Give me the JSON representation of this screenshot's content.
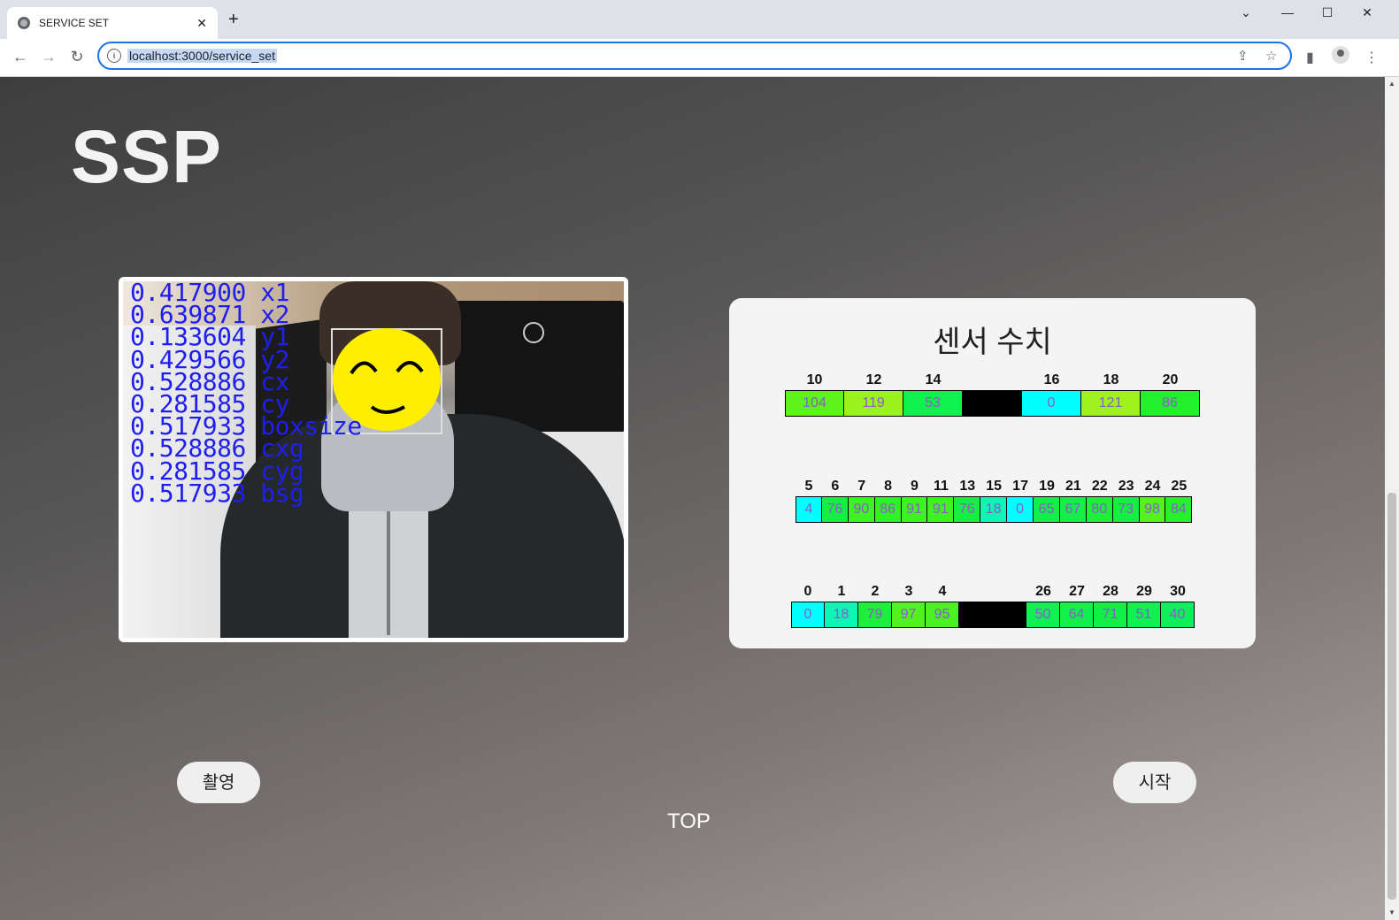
{
  "browser": {
    "tab_title": "SERVICE SET",
    "tab_close": "✕",
    "new_tab": "+",
    "url": "localhost:3000/service_set",
    "controls": {
      "dropdown": "⌄",
      "minimize": "—",
      "maximize": "☐",
      "close": "✕"
    },
    "nav": {
      "back": "←",
      "forward": "→",
      "reload": "↻"
    },
    "icons": {
      "info": "i",
      "share": "⇪",
      "star": "☆",
      "sidepanel": "▮",
      "menu": "⋮"
    }
  },
  "page": {
    "logo": "SSP",
    "camera": {
      "readout": [
        "0.417900 x1",
        "0.639871 x2",
        "0.133604 y1",
        "0.429566 y2",
        "0.528886 cx",
        "0.281585 cy",
        "0.517933 boxsize",
        "0.528886 cxg",
        "0.281585 cyg",
        "0.517933 bsg"
      ]
    },
    "sensor": {
      "title": "센서 수치",
      "rows": [
        {
          "cells": [
            {
              "label": "10",
              "value": "104",
              "color": "#5ef11b"
            },
            {
              "label": "12",
              "value": "119",
              "color": "#9af21e"
            },
            {
              "label": "14",
              "value": "53",
              "color": "#10f04e"
            },
            {
              "label": "",
              "value": "",
              "color": "#000000"
            },
            {
              "label": "16",
              "value": "0",
              "color": "#00ffff"
            },
            {
              "label": "18",
              "value": "121",
              "color": "#a0f21e"
            },
            {
              "label": "20",
              "value": "86",
              "color": "#22f12e"
            }
          ]
        },
        {
          "cells": [
            {
              "label": "5",
              "value": "4",
              "color": "#00ffff"
            },
            {
              "label": "6",
              "value": "76",
              "color": "#13f043"
            },
            {
              "label": "7",
              "value": "90",
              "color": "#3ff126"
            },
            {
              "label": "8",
              "value": "86",
              "color": "#32f129"
            },
            {
              "label": "9",
              "value": "91",
              "color": "#40f126"
            },
            {
              "label": "11",
              "value": "91",
              "color": "#40f126"
            },
            {
              "label": "13",
              "value": "76",
              "color": "#13f043"
            },
            {
              "label": "15",
              "value": "18",
              "color": "#0ef6b3"
            },
            {
              "label": "17",
              "value": "0",
              "color": "#00ffff"
            },
            {
              "label": "19",
              "value": "65",
              "color": "#11f04a"
            },
            {
              "label": "21",
              "value": "67",
              "color": "#11f048"
            },
            {
              "label": "22",
              "value": "80",
              "color": "#1cf03a"
            },
            {
              "label": "23",
              "value": "73",
              "color": "#12f045"
            },
            {
              "label": "24",
              "value": "98",
              "color": "#56f120"
            },
            {
              "label": "25",
              "value": "84",
              "color": "#26f12f"
            }
          ]
        },
        {
          "cells": [
            {
              "label": "0",
              "value": "0",
              "color": "#00ffff"
            },
            {
              "label": "1",
              "value": "18",
              "color": "#0ef6b3"
            },
            {
              "label": "2",
              "value": "79",
              "color": "#1cf03a"
            },
            {
              "label": "3",
              "value": "97",
              "color": "#52f120"
            },
            {
              "label": "4",
              "value": "95",
              "color": "#4cf121"
            },
            {
              "label": "",
              "value": "",
              "color": "#000000"
            },
            {
              "label": "",
              "value": "",
              "color": "#000000"
            },
            {
              "label": "26",
              "value": "50",
              "color": "#0ff052"
            },
            {
              "label": "27",
              "value": "64",
              "color": "#11f04b"
            },
            {
              "label": "28",
              "value": "71",
              "color": "#12f046"
            },
            {
              "label": "29",
              "value": "51",
              "color": "#0ff051"
            },
            {
              "label": "30",
              "value": "40",
              "color": "#0df05b"
            }
          ]
        }
      ]
    },
    "buttons": {
      "capture": "촬영",
      "start": "시작"
    },
    "top_link": "TOP"
  }
}
